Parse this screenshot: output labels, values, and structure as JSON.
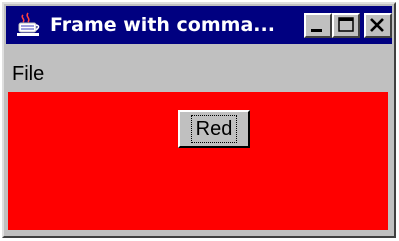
{
  "window": {
    "title": "Frame with comma..."
  },
  "menubar": {
    "items": [
      {
        "label": "File"
      }
    ]
  },
  "content": {
    "background_color": "#ff0000",
    "button_label": "Red"
  },
  "icons": {
    "app": "java-cup-icon",
    "minimize": "minimize-icon",
    "maximize": "maximize-icon",
    "close": "close-icon"
  },
  "colors": {
    "titlebar": "#000080",
    "chrome": "#c0c0c0",
    "content": "#ff0000"
  }
}
